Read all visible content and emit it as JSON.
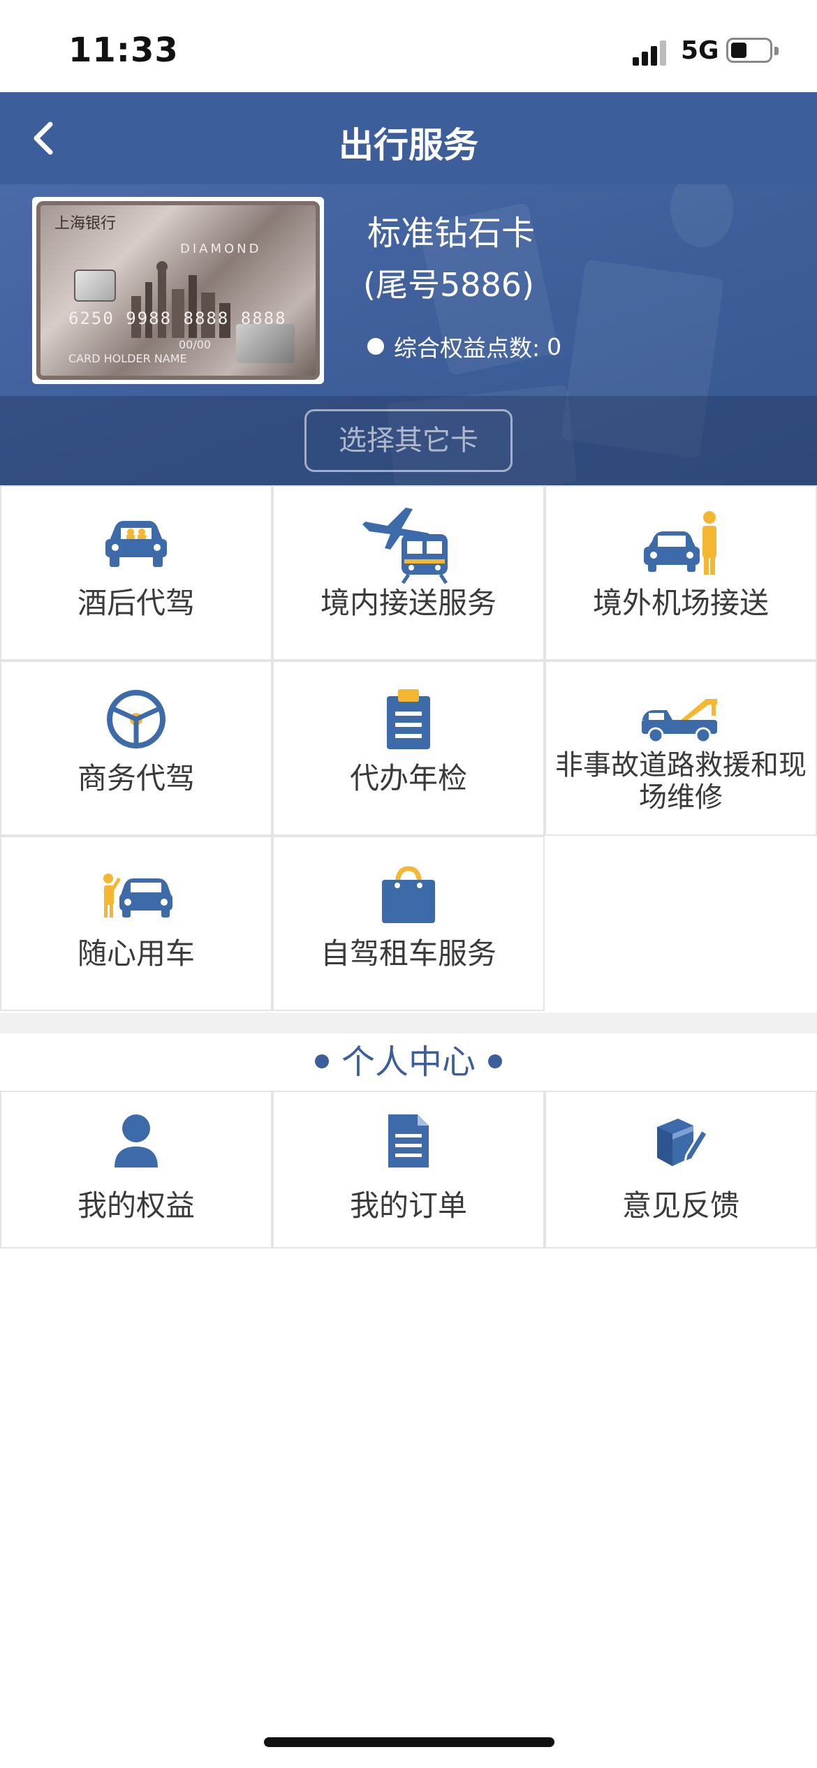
{
  "status_bar": {
    "time": "11:33",
    "network": "5G"
  },
  "nav": {
    "title": "出行服务"
  },
  "card": {
    "name": "标准钻石卡",
    "tail": "(尾号5886)",
    "points_label": "综合权益点数:",
    "points_value": "0",
    "select_button": "选择其它卡",
    "image_text": {
      "bank": "上海银行",
      "diamond": "DIAMOND",
      "number": "6250 9988 8888 8888",
      "expiry": "00/00",
      "holder": "CARD HOLDER NAME"
    }
  },
  "services": [
    {
      "label": "酒后代驾",
      "icon": "car-drivers-icon"
    },
    {
      "label": "境内接送服务",
      "icon": "plane-train-icon"
    },
    {
      "label": "境外机场接送",
      "icon": "car-person-icon"
    },
    {
      "label": "商务代驾",
      "icon": "steering-wheel-icon"
    },
    {
      "label": "代办年检",
      "icon": "clipboard-icon"
    },
    {
      "label": "非事故道路救援和现场维修",
      "icon": "tow-truck-icon"
    },
    {
      "label": "随心用车",
      "icon": "person-car-icon"
    },
    {
      "label": "自驾租车服务",
      "icon": "rental-bag-icon"
    }
  ],
  "personal": {
    "title": "个人中心",
    "items": [
      {
        "label": "我的权益",
        "icon": "user-icon"
      },
      {
        "label": "我的订单",
        "icon": "document-icon"
      },
      {
        "label": "意见反馈",
        "icon": "feedback-icon"
      }
    ]
  },
  "colors": {
    "primary": "#3c5e9b",
    "accent": "#f5b731",
    "icon_blue": "#3d6aa8"
  }
}
